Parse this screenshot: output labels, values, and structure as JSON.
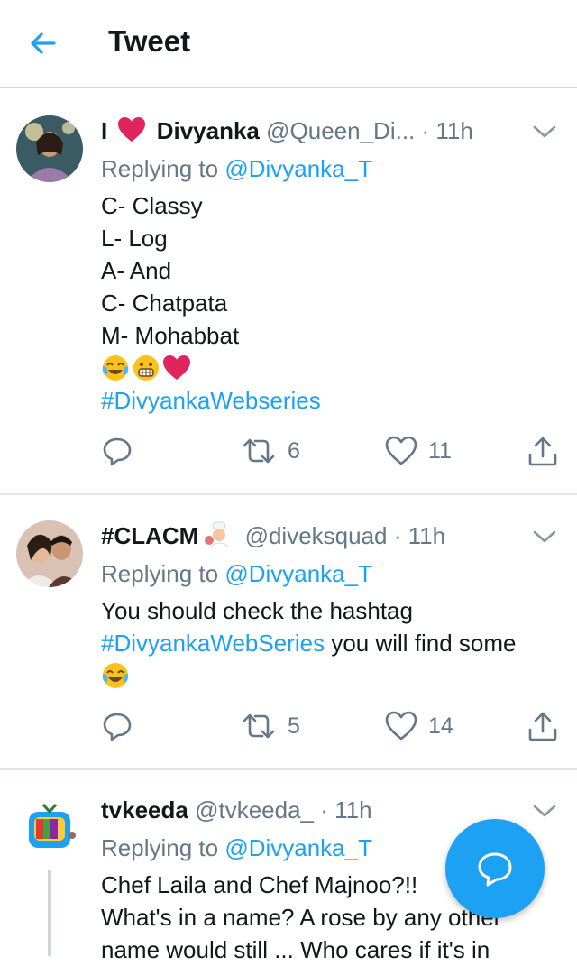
{
  "header": {
    "title": "Tweet",
    "back_icon": "arrow-left-icon",
    "accent": "#1da1f2"
  },
  "tweets": [
    {
      "name_prefix": "I",
      "name": "Divyanka",
      "handle": "@Queen_Di...",
      "dot": "·",
      "time": "11h",
      "replying_label": "Replying to",
      "replying_to": "@Divyanka_T",
      "lines": [
        "C- Classy",
        "L- Log",
        "A- And",
        "C- Chatpata",
        "M- Mohabbat"
      ],
      "emojis": [
        "face-with-tears-of-joy-emoji",
        "grimacing-face-emoji",
        "red-heart-emoji"
      ],
      "hashtag": "#DivyankaWebseries",
      "retweets": "6",
      "likes": "11"
    },
    {
      "name": "#CLACM",
      "handle": "@diveksquad",
      "dot": "·",
      "time": "11h",
      "replying_label": "Replying to",
      "replying_to": "@Divyanka_T",
      "text1": "You should check the hashtag",
      "hashtag": "#DivyankaWebSeries",
      "text2": " you will find some",
      "retweets": "5",
      "likes": "14"
    },
    {
      "name": "tvkeeda",
      "handle": "@tvkeeda_",
      "dot": "·",
      "time": "11h",
      "replying_label": "Replying to",
      "replying_to": "@Divyanka_T",
      "line1": "Chef Laila and Chef Majnoo?!!",
      "line2": "What's in a name? A rose by any other",
      "line3": "name would still ... Who cares if it's in"
    }
  ],
  "fab": {
    "icon": "compose-reply-icon"
  }
}
